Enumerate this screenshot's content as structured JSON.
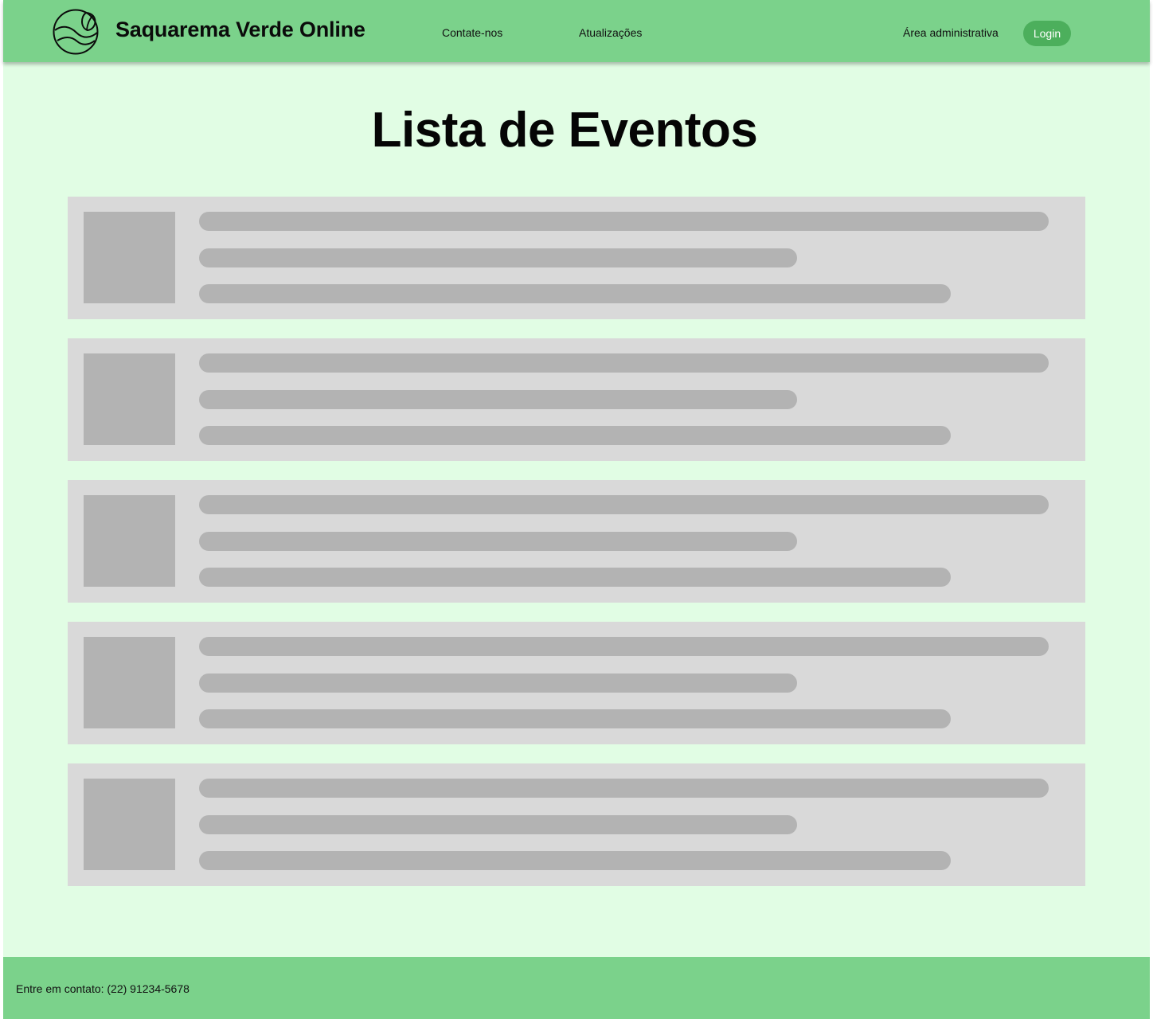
{
  "header": {
    "site_title": "Saquarema Verde Online",
    "nav": {
      "contact": "Contate-nos",
      "updates": "Atualizações",
      "admin": "Área administrativa",
      "login": "Login"
    }
  },
  "main": {
    "title": "Lista de Eventos",
    "events_count_placeholders": 5
  },
  "footer": {
    "contact_text": "Entre em contato: (22) 91234-5678"
  },
  "colors": {
    "header_bg": "#7bd28b",
    "page_bg": "#e1fde4",
    "login_button": "#4caf5c",
    "placeholder_card": "#d9d9d9",
    "placeholder_block": "#b3b3b3"
  },
  "icons": {
    "logo": "leaf-wave-logo-icon"
  }
}
